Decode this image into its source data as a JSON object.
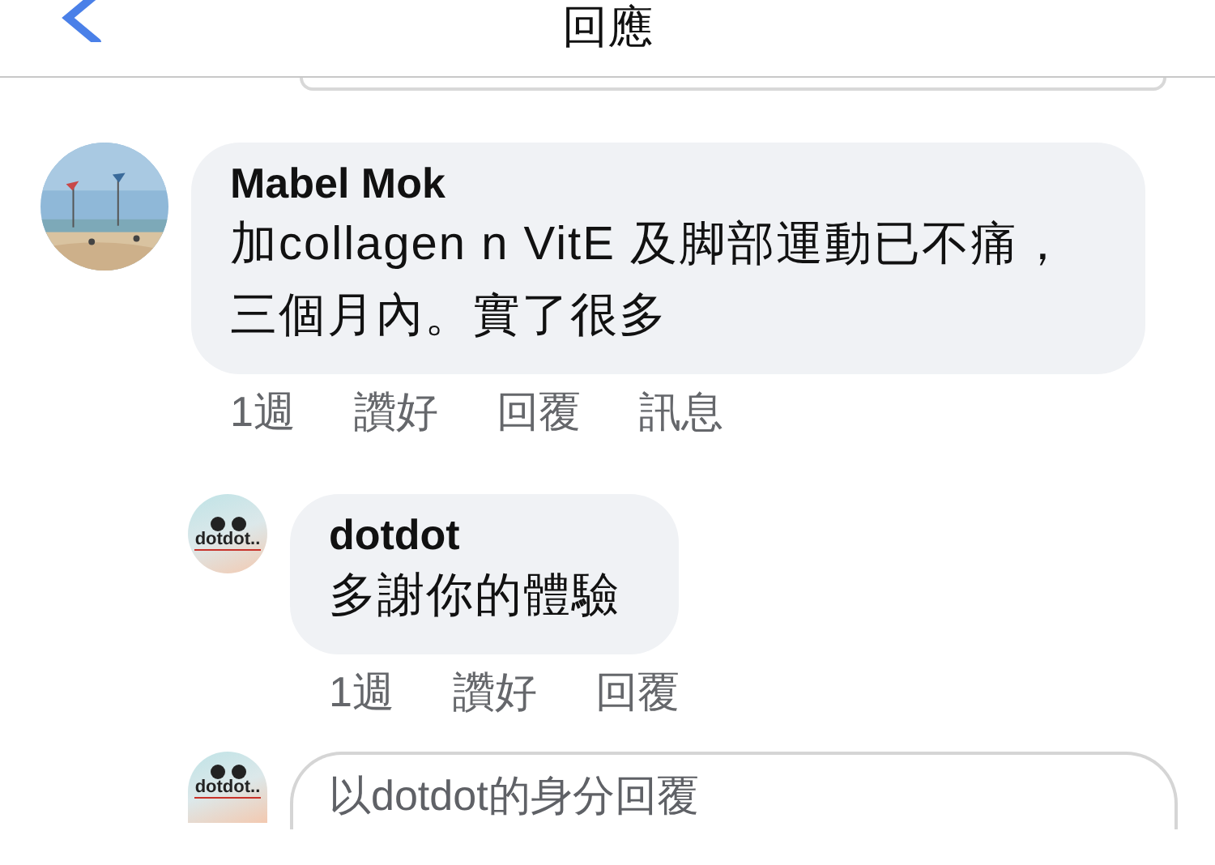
{
  "header": {
    "title": "回應"
  },
  "comments": [
    {
      "author": "Mabel Mok",
      "text": "加collagen n VitE 及脚部運動已不痛，三個月內。實了很多",
      "actions": [
        "1週",
        "讚好",
        "回覆",
        "訊息"
      ],
      "replies": [
        {
          "author": "dotdot",
          "avatar": {
            "kind": "logo",
            "logo_text": "dotdot.."
          },
          "text": "多謝你的體驗",
          "actions": [
            "1週",
            "讚好",
            "回覆"
          ]
        }
      ]
    }
  ],
  "reply_box": {
    "avatar": {
      "kind": "logo",
      "logo_text": "dotdot.."
    },
    "placeholder": "以dotdot的身分回覆"
  }
}
